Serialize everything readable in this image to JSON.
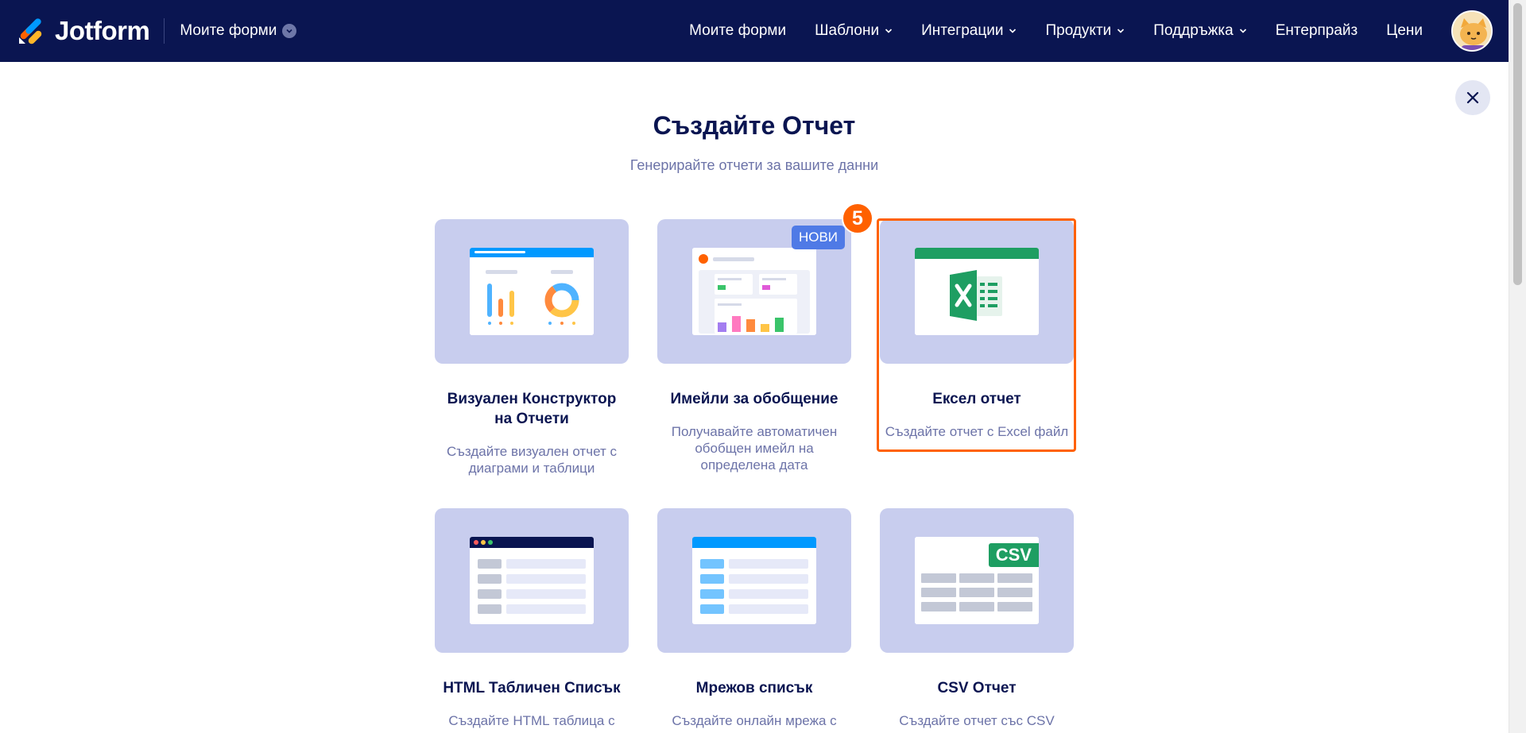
{
  "header": {
    "brand": "Jotform",
    "my_forms_dropdown": "Моите форми",
    "nav": [
      {
        "label": "Моите форми"
      },
      {
        "label": "Шаблони"
      },
      {
        "label": "Интеграции"
      },
      {
        "label": "Продукти"
      },
      {
        "label": "Поддръжка"
      },
      {
        "label": "Ентерпрайз"
      },
      {
        "label": "Цени"
      }
    ]
  },
  "modal": {
    "title": "Създайте Отчет",
    "subtitle": "Генерирайте отчети за вашите данни",
    "step_badge": "5",
    "new_badge": "НОВИ",
    "csv_tag": "CSV",
    "cards": [
      {
        "name": "Визуален Конструктор на Отчети",
        "description": "Създайте визуален отчет с диаграми и таблици"
      },
      {
        "name": "Имейли за обобщение",
        "description": "Получавайте автоматичен обобщен имейл на определена дата"
      },
      {
        "name": "Ексел отчет",
        "description": "Създайте отчет с Excel файл"
      },
      {
        "name": "HTML Табличен Списък",
        "description": "Създайте HTML таблица с"
      },
      {
        "name": "Мрежов списък",
        "description": "Създайте онлайн мрежа с"
      },
      {
        "name": "CSV Отчет",
        "description": "Създайте отчет със CSV"
      }
    ]
  },
  "colors": {
    "header_bg": "#0a1551",
    "tile_bg": "#c8cdee",
    "accent_orange": "#ff6100",
    "excel_green": "#1e9e62",
    "new_badge_blue": "#4f7ae6"
  }
}
